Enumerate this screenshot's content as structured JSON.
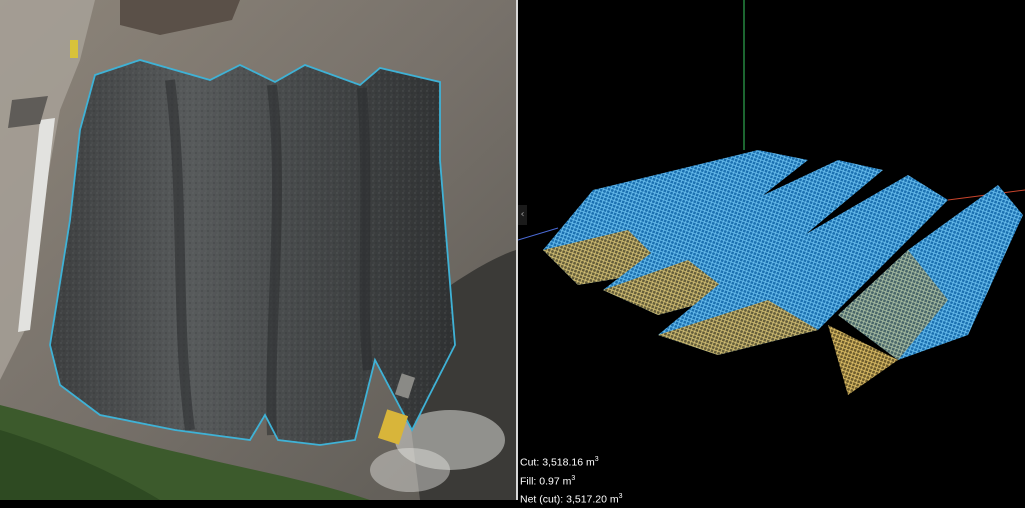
{
  "colors": {
    "boundary": "#3fb2d6",
    "mesh_top": "#3a9ad6",
    "mesh_bottom": "#c9a24a",
    "axis_green": "#2fa84f",
    "axis_red": "#c8442c",
    "axis_blue": "#4a6ad6"
  },
  "icons": {
    "collapse_handle": "chevron-left-icon"
  },
  "collapse_handle_glyph": "‹",
  "volume": {
    "cut_label": "Cut:",
    "cut_value": "3,518.16 m",
    "fill_label": "Fill:",
    "fill_value": "0.97 m",
    "net_label": "Net (cut):",
    "net_value": "3,517.20 m",
    "unit_exponent": "3"
  }
}
